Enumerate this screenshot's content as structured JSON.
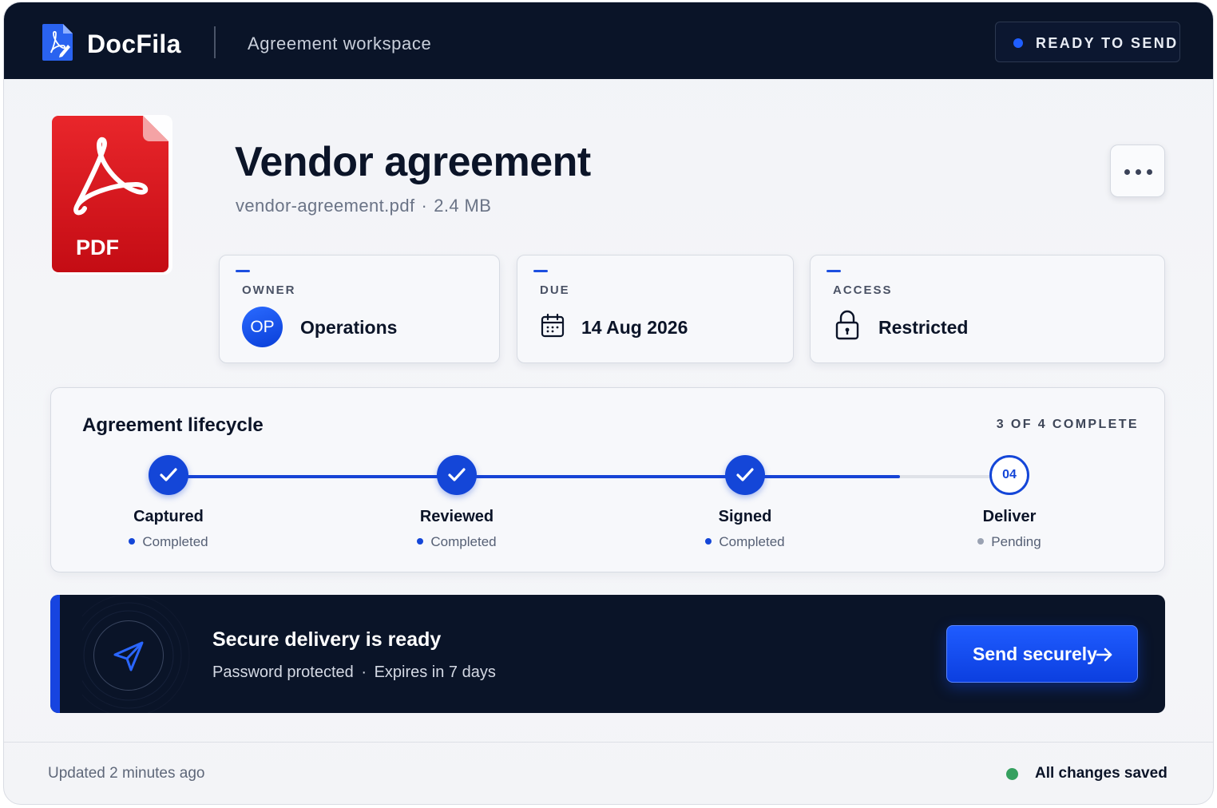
{
  "header": {
    "app_name": "DocFila",
    "workspace": "Agreement workspace",
    "status": "READY TO SEND"
  },
  "document": {
    "file_type_badge": "PDF",
    "title": "Vendor agreement",
    "filename": "vendor-agreement.pdf",
    "size": "2.4 MB",
    "separator": "·"
  },
  "cards": {
    "owner": {
      "label": "OWNER",
      "avatar_initials": "OP",
      "value": "Operations"
    },
    "due": {
      "label": "DUE",
      "value": "14 Aug 2026",
      "icon": "calendar-icon"
    },
    "access": {
      "label": "ACCESS",
      "value": "Restricted",
      "icon": "lock-icon"
    }
  },
  "lifecycle": {
    "title": "Agreement lifecycle",
    "progress_label": "3 OF 4 COMPLETE",
    "completed_fraction": 0.87,
    "steps": [
      {
        "name": "Captured",
        "state": "Completed",
        "done": true
      },
      {
        "name": "Reviewed",
        "state": "Completed",
        "done": true
      },
      {
        "name": "Signed",
        "state": "Completed",
        "done": true
      },
      {
        "name": "Deliver",
        "state": "Pending",
        "done": false,
        "number": "04"
      }
    ]
  },
  "delivery": {
    "title": "Secure delivery is ready",
    "protection": "Password protected",
    "separator": "·",
    "expiry": "Expires in 7 days",
    "button_label": "Send securely"
  },
  "footer": {
    "updated": "Updated 2 minutes ago",
    "saved": "All changes saved"
  },
  "colors": {
    "navy": "#0a1428",
    "accent_blue": "#1446d8",
    "pdf_red": "#d8141a",
    "saved_green": "#35a05f"
  }
}
